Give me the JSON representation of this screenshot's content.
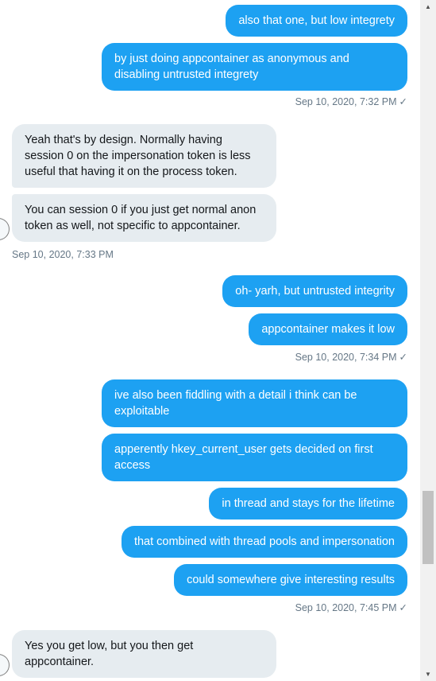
{
  "messages": [
    {
      "text": "also that one, but low integrety"
    },
    {
      "text": "by just doing appcontainer as anonymous and\ndisabling untrusted integrety"
    },
    {
      "text": "Yeah that's by design. Normally having\nsession 0 on the impersonation token is less\nuseful that having it on the process token."
    },
    {
      "text": "You can session 0 if you just get normal anon\ntoken as well, not specific to appcontainer."
    },
    {
      "text": "oh- yarh, but untrusted integrity"
    },
    {
      "text": "appcontainer makes it low"
    },
    {
      "text": "ive also been fiddling with a detail i think can be\nexploitable"
    },
    {
      "text": "apperently hkey_current_user gets decided on first\naccess"
    },
    {
      "text": "in thread and stays for the lifetime"
    },
    {
      "text": "that combined with thread pools and impersonation"
    },
    {
      "text": "could somewhere give interesting results"
    },
    {
      "text": "Yes you get low, but you then get\nappcontainer."
    }
  ],
  "timestamps": [
    {
      "text": "Sep 10, 2020, 7:32 PM"
    },
    {
      "text": "Sep 10, 2020, 7:33 PM"
    },
    {
      "text": "Sep 10, 2020, 7:34 PM"
    },
    {
      "text": "Sep 10, 2020, 7:45 PM"
    }
  ],
  "icons": {
    "read_check": "✓",
    "scroll_up": "▲",
    "scroll_down": "▼"
  },
  "colors": {
    "outgoing_bubble": "#1da1f2",
    "incoming_bubble": "#e6ecf0",
    "timestamp_text": "#657786"
  }
}
